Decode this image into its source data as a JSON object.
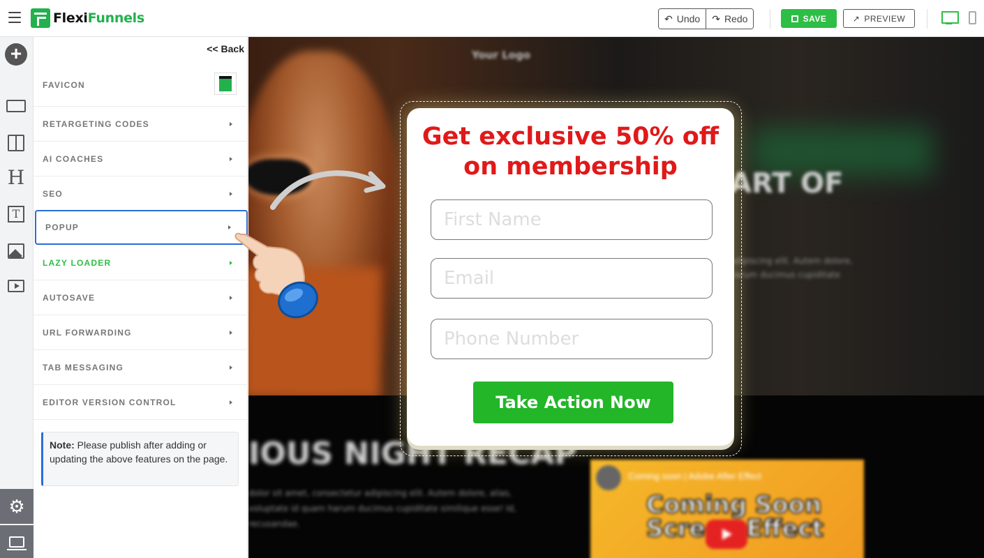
{
  "app": {
    "logo_prefix": "Flexi",
    "logo_suffix": "Funnels"
  },
  "toolbar": {
    "undo_label": "Undo",
    "redo_label": "Redo",
    "save_label": "SAVE",
    "preview_label": "PREVIEW"
  },
  "panel": {
    "back_label": "<< Back",
    "items": [
      {
        "label": "FAVICON"
      },
      {
        "label": "RETARGETING CODES"
      },
      {
        "label": "AI COACHES"
      },
      {
        "label": "SEO"
      },
      {
        "label": "POPUP"
      },
      {
        "label": "LAZY LOADER"
      },
      {
        "label": "AUTOSAVE"
      },
      {
        "label": "URL FORWARDING"
      },
      {
        "label": "TAB MESSAGING"
      },
      {
        "label": "EDITOR VERSION CONTROL"
      }
    ],
    "note_bold": "Note:",
    "note_text": " Please publish after adding or updating the above features on the page."
  },
  "canvas": {
    "logo_text": "Your Logo",
    "hero_heading": "ART OF",
    "hero_paragraph": "adipiscing elit. Autem dolore, harum ducimus cupiditate",
    "section_heading": "IOUS NIGHT RECAP",
    "section_paragraph": "dolor sit amet, consectetur adipiscing elit. Autem dolore, alias, voluptate id quam harum ducimus cupiditate similique esse! Id, recusandae.",
    "video_header": "Coming soon | Adobe After Effect",
    "video_title_line1": "Coming Soon",
    "video_title_line2": "Screen Effect"
  },
  "popup": {
    "title": "Get exclusive 50% off on membership",
    "first_name_placeholder": "First Name",
    "email_placeholder": "Email",
    "phone_placeholder": "Phone Number",
    "cta_label": "Take Action Now",
    "title_color": "#e11919",
    "cta_color": "#22b628"
  },
  "colors": {
    "accent": "#2dbe45",
    "active_border": "#2b6dd6"
  }
}
